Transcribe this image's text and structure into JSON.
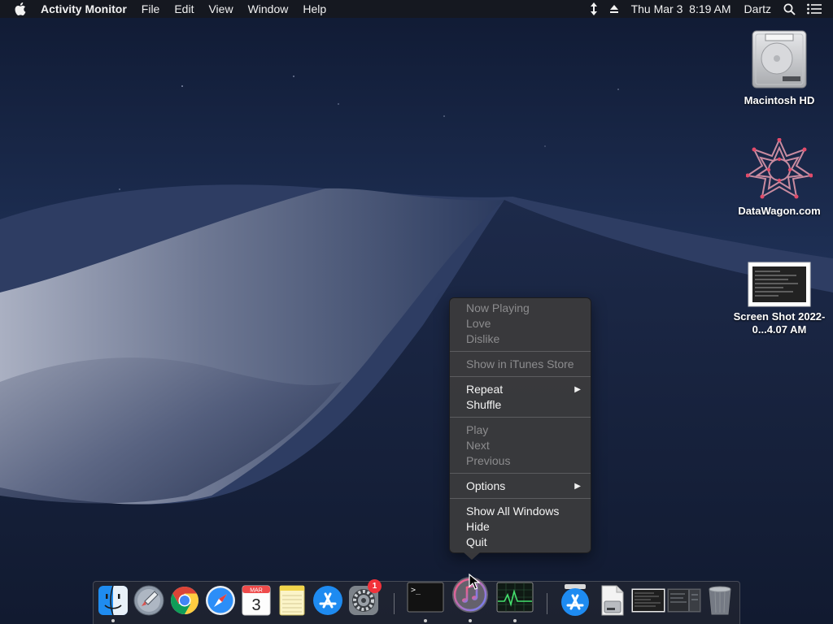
{
  "menubar": {
    "app_name": "Activity Monitor",
    "menus": [
      "File",
      "Edit",
      "View",
      "Window",
      "Help"
    ],
    "datetime": "Thu Mar 3  8:19 AM",
    "user": "Dartz",
    "icons": [
      "apple-icon",
      "sync-arrows-icon",
      "eject-icon",
      "spotlight-icon",
      "notification-center-icon"
    ]
  },
  "desktop": {
    "icons": [
      {
        "label": "Macintosh HD",
        "icon": "hard-drive-icon"
      },
      {
        "label": "DataWagon.com",
        "icon": "datawagon-logo-icon"
      },
      {
        "label": "Screen Shot 2022-0...4.07 AM",
        "icon": "screenshot-file-icon"
      }
    ]
  },
  "context_menu": {
    "app": "iTunes",
    "groups": [
      [
        {
          "label": "Now Playing",
          "enabled": false
        },
        {
          "label": "Love",
          "enabled": false
        },
        {
          "label": "Dislike",
          "enabled": false
        }
      ],
      [
        {
          "label": "Show in iTunes Store",
          "enabled": false
        }
      ],
      [
        {
          "label": "Repeat",
          "enabled": true,
          "submenu": true
        },
        {
          "label": "Shuffle",
          "enabled": true
        }
      ],
      [
        {
          "label": "Play",
          "enabled": false
        },
        {
          "label": "Next",
          "enabled": false
        },
        {
          "label": "Previous",
          "enabled": false
        }
      ],
      [
        {
          "label": "Options",
          "enabled": true,
          "submenu": true
        }
      ],
      [
        {
          "label": "Show All Windows",
          "enabled": true
        },
        {
          "label": "Hide",
          "enabled": true
        },
        {
          "label": "Quit",
          "enabled": true
        }
      ]
    ]
  },
  "dock": {
    "apps": [
      {
        "name": "finder",
        "running": true
      },
      {
        "name": "launchpad",
        "running": false
      },
      {
        "name": "chrome",
        "running": false
      },
      {
        "name": "safari",
        "running": false
      },
      {
        "name": "calendar",
        "running": false,
        "month": "MAR",
        "day": "3"
      },
      {
        "name": "notes",
        "running": false
      },
      {
        "name": "app-store",
        "running": false
      },
      {
        "name": "system-preferences",
        "running": false,
        "badge": "1"
      },
      {
        "name": "terminal",
        "running": true
      },
      {
        "name": "itunes",
        "running": true
      },
      {
        "name": "activity-monitor",
        "running": true
      }
    ],
    "others": [
      "applications-folder",
      "documents-folder",
      "screenshot-thumb-1",
      "screenshot-thumb-2",
      "trash"
    ]
  },
  "colors": {
    "menu_bg": "#3a3a3c",
    "menu_text": "#f4f4f4",
    "menu_disabled": "#8c8c8e",
    "badge_red": "#f2323a"
  }
}
